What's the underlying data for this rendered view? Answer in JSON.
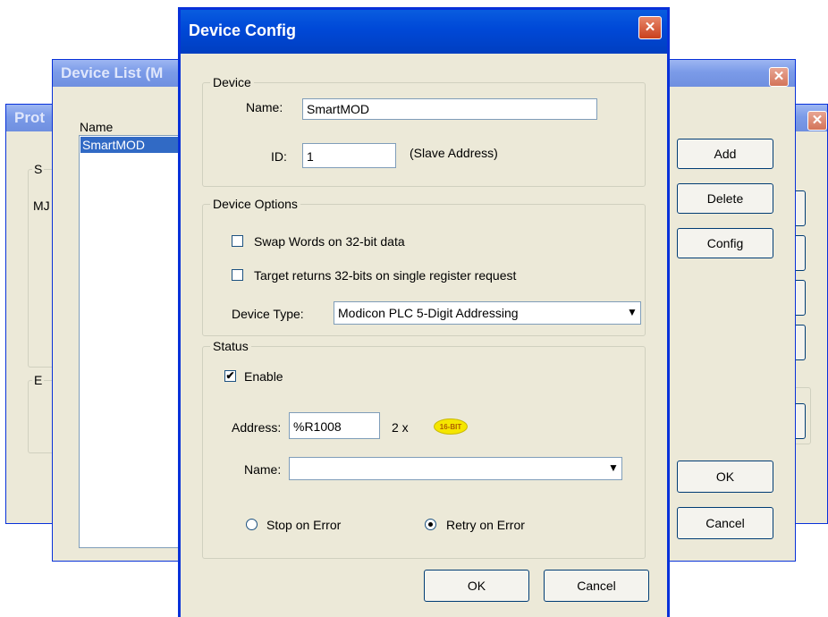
{
  "protocol_window": {
    "title": "Prot",
    "close_label": "✕",
    "group1_label": "S",
    "item_label": "MJ",
    "group2_label": "E"
  },
  "device_list_window": {
    "title": "Device List (M",
    "close_label": "✕",
    "list_header": "Name",
    "items": [
      "SmartMOD"
    ],
    "add_label": "Add",
    "delete_label": "Delete",
    "config_label": "Config",
    "ok_label": "OK",
    "cancel_label": "Cancel"
  },
  "device_config": {
    "title": "Device Config",
    "close_label": "✕",
    "device_group": {
      "legend": "Device",
      "name_label": "Name:",
      "name_value": "SmartMOD",
      "id_label": "ID:",
      "id_value": "1",
      "id_hint": "(Slave Address)"
    },
    "options_group": {
      "legend": "Device Options",
      "swap_words_label": "Swap Words on 32-bit data",
      "swap_words_checked": false,
      "target_32_label": "Target returns 32-bits on single register request",
      "target_32_checked": false,
      "device_type_label": "Device Type:",
      "device_type_value": "Modicon PLC 5-Digit Addressing"
    },
    "status_group": {
      "legend": "Status",
      "enable_label": "Enable",
      "enable_checked": true,
      "address_label": "Address:",
      "address_value": "%R1008",
      "multiplier": "2 x",
      "badge_text": "16-BIT",
      "name_label": "Name:",
      "name_value": "",
      "stop_on_error_label": "Stop on Error",
      "retry_on_error_label": "Retry on Error",
      "selected_error_mode": "retry"
    },
    "ok_label": "OK",
    "cancel_label": "Cancel",
    "check_mark": "✔",
    "dropdown_arrow": "▼"
  }
}
